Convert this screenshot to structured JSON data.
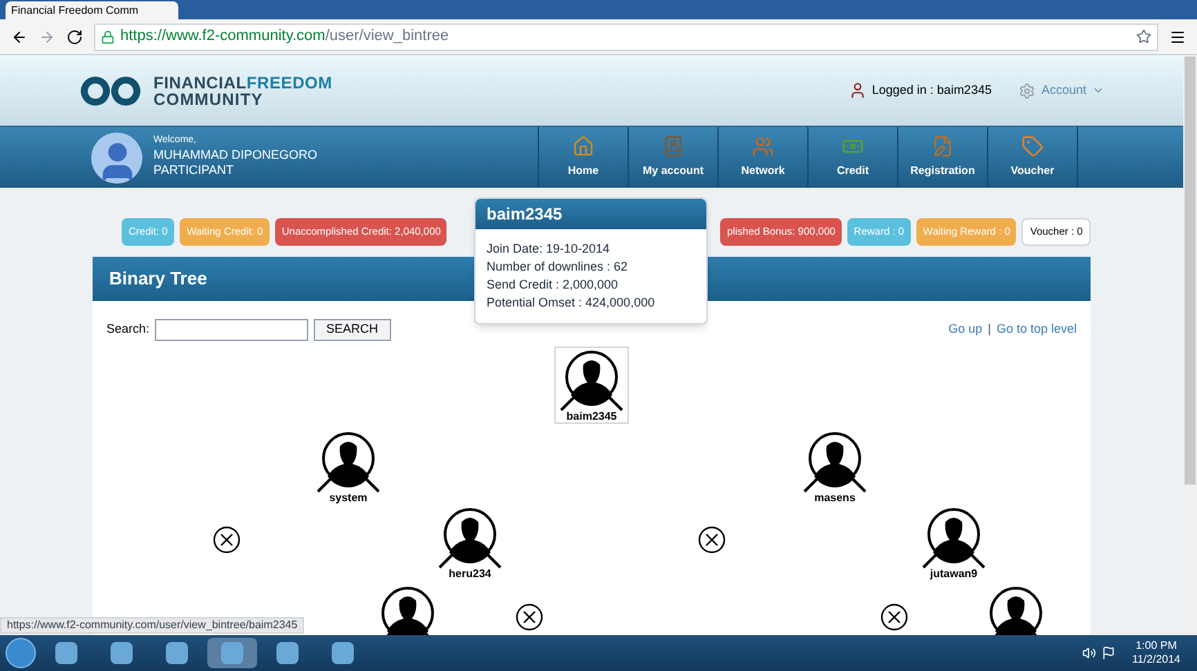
{
  "browser": {
    "tab_title": "Financial Freedom Comm",
    "url_host": "https://www.f2-community.com",
    "url_path": "/user/view_bintree"
  },
  "header": {
    "logo_word_1": "FINANCIAL",
    "logo_word_2": "FREEDOM",
    "logo_word_3": "COMMUNITY",
    "logged_in": "Logged in : baim2345",
    "account_menu": "Account"
  },
  "user": {
    "welcome": "Welcome,",
    "name": "MUHAMMAD DIPONEGORO",
    "role": "PARTICIPANT"
  },
  "nav": [
    {
      "label": "Home",
      "kind": "home"
    },
    {
      "label": "My account",
      "kind": "account"
    },
    {
      "label": "Network",
      "kind": "network"
    },
    {
      "label": "Credit",
      "kind": "credit"
    },
    {
      "label": "Registration",
      "kind": "registration"
    },
    {
      "label": "Voucher",
      "kind": "voucher"
    }
  ],
  "badges": [
    {
      "text": "Credit: 0",
      "color": "#5bc0de"
    },
    {
      "text": "Waiting Credit: 0",
      "color": "#f0ad4e"
    },
    {
      "text": "Unaccomplished Credit: 2,040,000",
      "color": "#d9534f"
    },
    {
      "text": "plished Bonus: 900,000",
      "color": "#d9534f",
      "covered": true
    },
    {
      "text": "Reward : 0",
      "color": "#5bc0de"
    },
    {
      "text": "Waiting Reward : 0",
      "color": "#f0ad4e"
    },
    {
      "text": "Voucher : 0",
      "color": "#ffffff"
    }
  ],
  "panel": {
    "title": "Binary Tree",
    "search_label": "Search:",
    "search_button": "SEARCH",
    "links": [
      "Go up",
      "Go to top level"
    ],
    "link_separator": "|"
  },
  "popup": {
    "title": "baim2345",
    "lines": [
      "Join Date: 19-10-2014",
      "Number of downlines : 62",
      "Send Credit : 2,000,000",
      "Potential Omset : 424,000,000"
    ]
  },
  "tree": {
    "kind": "member",
    "name": "baim2345",
    "selected": true,
    "children": [
      {
        "kind": "member",
        "name": "system",
        "selected": false,
        "children": [
          {
            "kind": "empty"
          },
          {
            "kind": "member",
            "name": "heru234",
            "selected": false,
            "children": [
              {
                "kind": "member",
                "selected": false
              },
              {
                "kind": "empty"
              }
            ]
          }
        ]
      },
      {
        "kind": "member",
        "name": "masens",
        "selected": false,
        "children": [
          {
            "kind": "empty"
          },
          {
            "kind": "member",
            "name": "jutawan9",
            "selected": false,
            "children": [
              {
                "kind": "empty"
              },
              {
                "kind": "member",
                "selected": false
              }
            ]
          }
        ]
      }
    ]
  },
  "status_bar": {
    "url": "https://www.f2-community.com/user/view_bintree/baim2345"
  },
  "taskbar": {
    "time": "1:00 PM",
    "date": "11/2/2014"
  }
}
